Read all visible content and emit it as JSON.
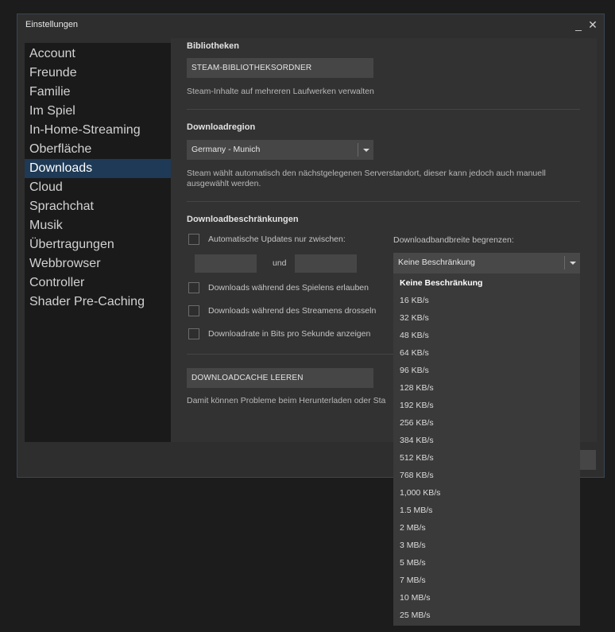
{
  "window": {
    "title": "Einstellungen",
    "minimize_glyph": "_",
    "close_glyph": "✕"
  },
  "sidebar": {
    "items": [
      {
        "label": "Account",
        "selected": false
      },
      {
        "label": "Freunde",
        "selected": false
      },
      {
        "label": "Familie",
        "selected": false
      },
      {
        "label": "Im Spiel",
        "selected": false
      },
      {
        "label": "In-Home-Streaming",
        "selected": false
      },
      {
        "label": "Oberfläche",
        "selected": false
      },
      {
        "label": "Downloads",
        "selected": true
      },
      {
        "label": "Cloud",
        "selected": false
      },
      {
        "label": "Sprachchat",
        "selected": false
      },
      {
        "label": "Musik",
        "selected": false
      },
      {
        "label": "Übertragungen",
        "selected": false
      },
      {
        "label": "Webbrowser",
        "selected": false
      },
      {
        "label": "Controller",
        "selected": false
      },
      {
        "label": "Shader Pre-Caching",
        "selected": false
      }
    ]
  },
  "libraries": {
    "title": "Bibliotheken",
    "button": "STEAM-BIBLIOTHEKSORDNER",
    "description": "Steam-Inhalte auf mehreren Laufwerken verwalten"
  },
  "region": {
    "title": "Downloadregion",
    "selected": "Germany - Munich",
    "description_line1": "Steam wählt automatisch den nächstgelegenen Serverstandort, dieser kann jedoch auch manuell",
    "description_line2": "ausgewählt werden."
  },
  "restrictions": {
    "title": "Downloadbeschränkungen",
    "auto_updates_label": "Automatische Updates nur zwischen:",
    "time_from": "",
    "between_word": "und",
    "time_to": "",
    "allow_while_playing": "Downloads während des Spielens erlauben",
    "throttle_while_streaming": "Downloads während des Streamens drosseln",
    "show_bits": "Downloadrate in Bits pro Sekunde anzeigen",
    "bandwidth_label": "Downloadbandbreite begrenzen:",
    "bandwidth_selected": "Keine Beschränkung",
    "bandwidth_options": [
      "Keine Beschränkung",
      "16 KB/s",
      "32 KB/s",
      "48 KB/s",
      "64 KB/s",
      "96 KB/s",
      "128 KB/s",
      "192 KB/s",
      "256 KB/s",
      "384 KB/s",
      "512 KB/s",
      "768 KB/s",
      "1,000 KB/s",
      "1.5 MB/s",
      "2 MB/s",
      "3 MB/s",
      "5 MB/s",
      "7 MB/s",
      "10 MB/s",
      "25 MB/s"
    ]
  },
  "cache": {
    "button": "DOWNLOADCACHE LEEREN",
    "description": "Damit können Probleme beim Herunterladen oder Sta"
  },
  "colors": {
    "selected_nav": "#1e3a56",
    "window_bg": "#2e2e2e",
    "content_bg": "#323232",
    "control_bg": "#464646"
  }
}
